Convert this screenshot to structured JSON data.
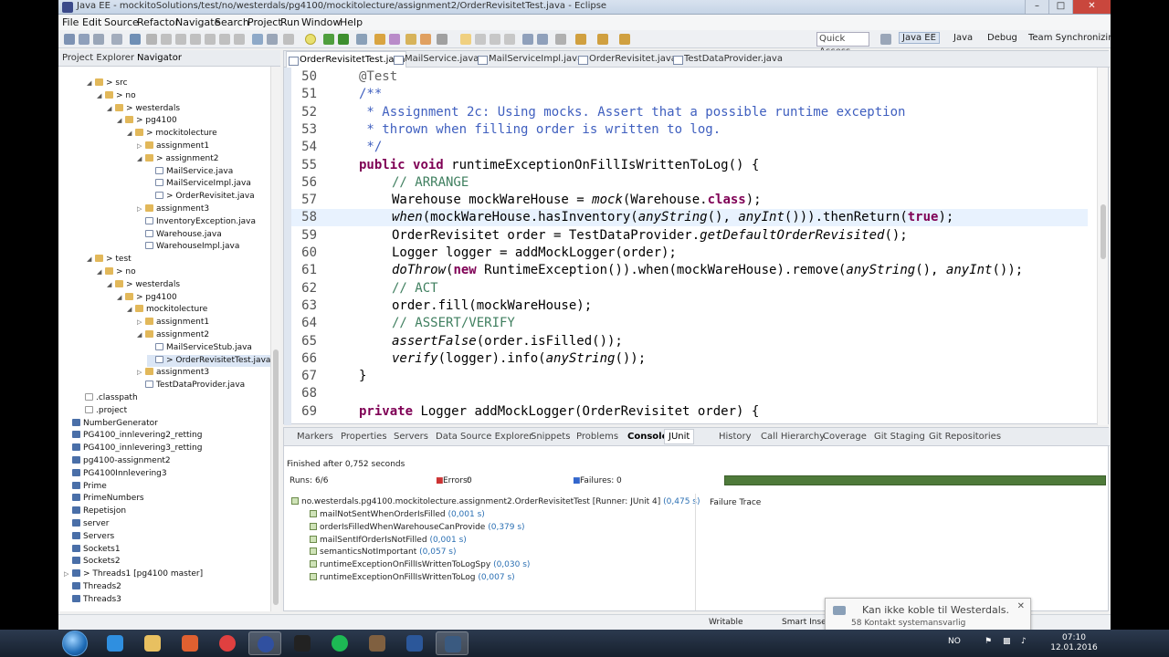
{
  "window": {
    "title": "Java EE - mockitoSolutions/test/no/westerdals/pg4100/mockitolecture/assignment2/OrderRevisitetTest.java - Eclipse"
  },
  "menu": [
    "File",
    "Edit",
    "Source",
    "Refactor",
    "Navigate",
    "Search",
    "Project",
    "Run",
    "Window",
    "Help"
  ],
  "toolbar": {
    "quick_access_placeholder": "Quick Access",
    "perspectives": [
      "Java EE",
      "Java",
      "Debug",
      "Team Synchronizing"
    ]
  },
  "left_panel": {
    "tabs": [
      "Project Explorer",
      "Navigator"
    ],
    "tree": [
      {
        "label": "> src",
        "depth": 1,
        "icon": "folder",
        "arrow": "down"
      },
      {
        "label": "> no",
        "depth": 2,
        "icon": "folder",
        "arrow": "down"
      },
      {
        "label": "> westerdals",
        "depth": 3,
        "icon": "folder",
        "arrow": "down"
      },
      {
        "label": "> pg4100",
        "depth": 4,
        "icon": "folder",
        "arrow": "down"
      },
      {
        "label": "> mockitolecture",
        "depth": 5,
        "icon": "folder",
        "arrow": "down"
      },
      {
        "label": "assignment1",
        "depth": 6,
        "icon": "folder",
        "arrow": "right"
      },
      {
        "label": "> assignment2",
        "depth": 6,
        "icon": "folder",
        "arrow": "down"
      },
      {
        "label": "MailService.java",
        "depth": 7,
        "icon": "java",
        "arrow": ""
      },
      {
        "label": "MailServiceImpl.java",
        "depth": 7,
        "icon": "java",
        "arrow": ""
      },
      {
        "label": "> OrderRevisitet.java",
        "depth": 7,
        "icon": "java",
        "arrow": ""
      },
      {
        "label": "assignment3",
        "depth": 6,
        "icon": "folder",
        "arrow": "right"
      },
      {
        "label": "InventoryException.java",
        "depth": 6,
        "icon": "java",
        "arrow": ""
      },
      {
        "label": "Warehouse.java",
        "depth": 6,
        "icon": "java",
        "arrow": ""
      },
      {
        "label": "WarehouseImpl.java",
        "depth": 6,
        "icon": "java",
        "arrow": ""
      },
      {
        "label": "> test",
        "depth": 1,
        "icon": "folder",
        "arrow": "down"
      },
      {
        "label": "> no",
        "depth": 2,
        "icon": "folder",
        "arrow": "down"
      },
      {
        "label": "> westerdals",
        "depth": 3,
        "icon": "folder",
        "arrow": "down"
      },
      {
        "label": "> pg4100",
        "depth": 4,
        "icon": "folder",
        "arrow": "down"
      },
      {
        "label": "mockitolecture",
        "depth": 5,
        "icon": "folder",
        "arrow": "down"
      },
      {
        "label": "assignment1",
        "depth": 6,
        "icon": "folder",
        "arrow": "right"
      },
      {
        "label": "assignment2",
        "depth": 6,
        "icon": "folder",
        "arrow": "down"
      },
      {
        "label": "MailServiceStub.java",
        "depth": 7,
        "icon": "java",
        "arrow": ""
      },
      {
        "label": "> OrderRevisitetTest.java",
        "depth": 7,
        "icon": "java",
        "arrow": "",
        "selected": true
      },
      {
        "label": "assignment3",
        "depth": 6,
        "icon": "folder",
        "arrow": "right"
      },
      {
        "label": "TestDataProvider.java",
        "depth": 6,
        "icon": "java",
        "arrow": ""
      },
      {
        "label": ".classpath",
        "depth": 0,
        "icon": "file",
        "arrow": ""
      },
      {
        "label": ".project",
        "depth": 0,
        "icon": "file",
        "arrow": ""
      },
      {
        "label": "NumberGenerator",
        "depth": -1,
        "icon": "proj",
        "arrow": ""
      },
      {
        "label": "PG4100_innlevering2_retting",
        "depth": -1,
        "icon": "proj",
        "arrow": ""
      },
      {
        "label": "PG4100_innlevering3_retting",
        "depth": -1,
        "icon": "proj",
        "arrow": ""
      },
      {
        "label": "pg4100-assignment2",
        "depth": -1,
        "icon": "proj",
        "arrow": ""
      },
      {
        "label": "PG4100Innlevering3",
        "depth": -1,
        "icon": "proj",
        "arrow": ""
      },
      {
        "label": "Prime",
        "depth": -1,
        "icon": "proj",
        "arrow": ""
      },
      {
        "label": "PrimeNumbers",
        "depth": -1,
        "icon": "proj",
        "arrow": ""
      },
      {
        "label": "Repetisjon",
        "depth": -1,
        "icon": "proj",
        "arrow": ""
      },
      {
        "label": "server",
        "depth": -1,
        "icon": "proj",
        "arrow": ""
      },
      {
        "label": "Servers",
        "depth": -1,
        "icon": "proj",
        "arrow": ""
      },
      {
        "label": "Sockets1",
        "depth": -1,
        "icon": "proj",
        "arrow": ""
      },
      {
        "label": "Sockets2",
        "depth": -1,
        "icon": "proj",
        "arrow": ""
      },
      {
        "label": "> Threads1  [pg4100 master]",
        "depth": -1,
        "icon": "proj",
        "arrow": "right"
      },
      {
        "label": "Threads2",
        "depth": -1,
        "icon": "proj",
        "arrow": ""
      },
      {
        "label": "Threads3",
        "depth": -1,
        "icon": "proj",
        "arrow": ""
      }
    ]
  },
  "editor": {
    "tabs": [
      "OrderRevisitetTest.java",
      "MailService.java",
      "MailServiceImpl.java",
      "OrderRevisitet.java",
      "TestDataProvider.java"
    ],
    "active_tab": 0,
    "current_line": 58,
    "lines": [
      {
        "n": "50",
        "indent": 0,
        "segs": [
          {
            "t": "@Test",
            "c": "ann"
          }
        ]
      },
      {
        "n": "51",
        "indent": 0,
        "segs": [
          {
            "t": "/**",
            "c": "jd"
          }
        ]
      },
      {
        "n": "52",
        "indent": 0,
        "segs": [
          {
            "t": " * Assignment 2c: Using mocks. Assert that a possible runtime exception",
            "c": "jd"
          }
        ]
      },
      {
        "n": "53",
        "indent": 0,
        "segs": [
          {
            "t": " * thrown when filling order is written to log.",
            "c": "jd"
          }
        ]
      },
      {
        "n": "54",
        "indent": 0,
        "segs": [
          {
            "t": " */",
            "c": "jd"
          }
        ]
      },
      {
        "n": "55",
        "indent": 0,
        "segs": [
          {
            "t": "public",
            "c": "kw"
          },
          {
            "t": " "
          },
          {
            "t": "void",
            "c": "kw"
          },
          {
            "t": " runtimeExceptionOnFillIsWrittenToLog() {"
          }
        ]
      },
      {
        "n": "56",
        "indent": 1,
        "segs": [
          {
            "t": "// ARRANGE",
            "c": "cm"
          }
        ]
      },
      {
        "n": "57",
        "indent": 1,
        "segs": [
          {
            "t": "Warehouse mockWareHouse = "
          },
          {
            "t": "mock",
            "c": "it"
          },
          {
            "t": "(Warehouse."
          },
          {
            "t": "class",
            "c": "kw"
          },
          {
            "t": ");"
          }
        ]
      },
      {
        "n": "58",
        "indent": 1,
        "segs": [
          {
            "t": "when",
            "c": "it"
          },
          {
            "t": "(mockWareHouse.hasInventory("
          },
          {
            "t": "anyString",
            "c": "it"
          },
          {
            "t": "(), "
          },
          {
            "t": "anyInt",
            "c": "it"
          },
          {
            "t": "())).thenReturn("
          },
          {
            "t": "true",
            "c": "kw"
          },
          {
            "t": ");"
          }
        ]
      },
      {
        "n": "59",
        "indent": 1,
        "segs": [
          {
            "t": "OrderRevisitet order = TestDataProvider."
          },
          {
            "t": "getDefaultOrderRevisited",
            "c": "it"
          },
          {
            "t": "();"
          }
        ]
      },
      {
        "n": "60",
        "indent": 1,
        "segs": [
          {
            "t": "Logger logger = addMockLogger(order);"
          }
        ]
      },
      {
        "n": "61",
        "indent": 1,
        "segs": [
          {
            "t": "doThrow",
            "c": "it"
          },
          {
            "t": "("
          },
          {
            "t": "new",
            "c": "kw"
          },
          {
            "t": " RuntimeException()).when(mockWareHouse).remove("
          },
          {
            "t": "anyString",
            "c": "it"
          },
          {
            "t": "(), "
          },
          {
            "t": "anyInt",
            "c": "it"
          },
          {
            "t": "());"
          }
        ]
      },
      {
        "n": "62",
        "indent": 1,
        "segs": [
          {
            "t": "// ACT",
            "c": "cm"
          }
        ]
      },
      {
        "n": "63",
        "indent": 1,
        "segs": [
          {
            "t": "order.fill(mockWareHouse);"
          }
        ]
      },
      {
        "n": "64",
        "indent": 1,
        "segs": [
          {
            "t": "// ASSERT/VERIFY",
            "c": "cm"
          }
        ]
      },
      {
        "n": "65",
        "indent": 1,
        "segs": [
          {
            "t": "assertFalse",
            "c": "it"
          },
          {
            "t": "(order.isFilled());"
          }
        ]
      },
      {
        "n": "66",
        "indent": 1,
        "segs": [
          {
            "t": "verify",
            "c": "it"
          },
          {
            "t": "(logger).info("
          },
          {
            "t": "anyString",
            "c": "it"
          },
          {
            "t": "());"
          }
        ]
      },
      {
        "n": "67",
        "indent": 0,
        "segs": [
          {
            "t": "}"
          }
        ]
      },
      {
        "n": "68",
        "indent": 0,
        "segs": [
          {
            "t": ""
          }
        ]
      },
      {
        "n": "69",
        "indent": 0,
        "segs": [
          {
            "t": "private",
            "c": "kw"
          },
          {
            "t": " Logger addMockLogger(OrderRevisitet order) {"
          }
        ]
      }
    ]
  },
  "bottom_panel": {
    "tabs": [
      "Markers",
      "Properties",
      "Servers",
      "Data Source Explorer",
      "Snippets",
      "Problems",
      "Console",
      "JUnit",
      "History",
      "Call Hierarchy",
      "Coverage",
      "Git Staging",
      "Git Repositories"
    ],
    "active_tab": "JUnit",
    "finished": "Finished after 0,752 seconds",
    "runs_label": "Runs:",
    "runs_value": "6/6",
    "errors_label": "Errors:",
    "errors_value": "0",
    "failures_label": "Failures:",
    "failures_value": "0",
    "progress_fraction": 1.0,
    "progress_color": "#4e7a3a",
    "suite": {
      "label": "no.westerdals.pg4100.mockitolecture.assignment2.OrderRevisitetTest [Runner: JUnit 4]",
      "time": "(0,475 s)"
    },
    "tests": [
      {
        "name": "mailNotSentWhenOrderIsFilled",
        "time": "(0,001 s)"
      },
      {
        "name": "orderIsFilledWhenWarehouseCanProvide",
        "time": "(0,379 s)"
      },
      {
        "name": "mailSentIfOrderIsNotFilled",
        "time": "(0,001 s)"
      },
      {
        "name": "semanticsNotImportant",
        "time": "(0,057 s)"
      },
      {
        "name": "runtimeExceptionOnFillIsWrittenToLogSpy",
        "time": "(0,030 s)"
      },
      {
        "name": "runtimeExceptionOnFillIsWrittenToLog",
        "time": "(0,007 s)"
      }
    ],
    "failure_trace": "Failure Trace"
  },
  "status_bar": {
    "writable": "Writable",
    "insert": "Smart Insert"
  },
  "notification": {
    "title": "Kan ikke koble til Westerdals.",
    "subtitle": "58 Kontakt systemansvarlig"
  },
  "taskbar": {
    "apps": [
      "ie",
      "explorer",
      "media",
      "chrome",
      "app5",
      "app6",
      "spotify",
      "app8",
      "word",
      "app10"
    ],
    "lang": "NO",
    "time": "07:10",
    "date": "12.01.2016"
  }
}
